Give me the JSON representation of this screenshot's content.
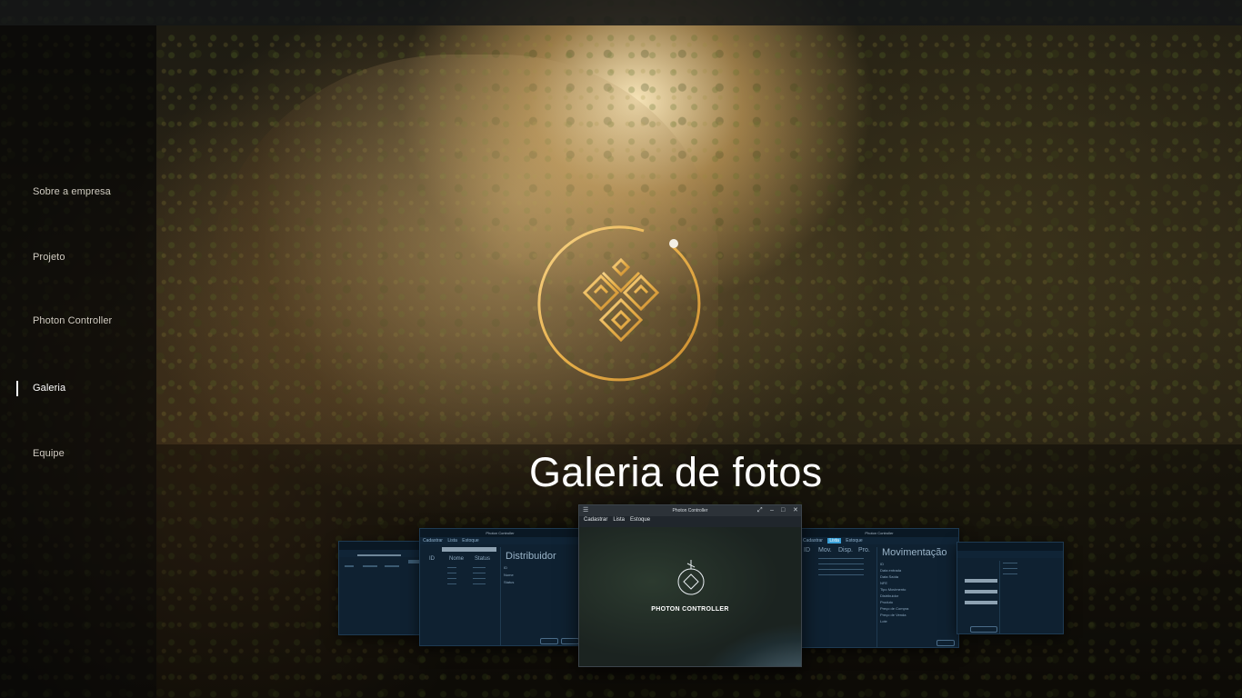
{
  "nav": {
    "items": [
      {
        "label": "Sobre a empresa",
        "active": false
      },
      {
        "label": "Projeto",
        "active": false
      },
      {
        "label": "Photon Controller",
        "active": false
      },
      {
        "label": "Galeria",
        "active": true
      },
      {
        "label": "Equipe",
        "active": false
      }
    ]
  },
  "gallery": {
    "title": "Galeria de fotos"
  },
  "screens": {
    "main": {
      "window_title": "Photon Controller",
      "menu": [
        "Cadastrar",
        "Lista",
        "Estoque"
      ],
      "brand": "PHOTON CONTROLLER"
    },
    "distribuidor": {
      "window_title": "Photon Controller",
      "menu": [
        "Cadastrar",
        "Lista",
        "Estoque"
      ],
      "heading": "Distribuidor",
      "columns": [
        "ID",
        "Nome",
        "Status"
      ],
      "fields": [
        "ID",
        "Nome",
        "Status"
      ]
    },
    "movimentacao": {
      "window_title": "Photon Controller",
      "menu": [
        "Cadastrar",
        "Lista",
        "Estoque"
      ],
      "heading": "Movimentação",
      "columns": [
        "ID",
        "Mov.",
        "Disp.",
        "Pro."
      ],
      "fields": [
        "ID",
        "Data entrada",
        "Data Saída",
        "NFE",
        "Tipo Movimento",
        "Distribuidor",
        "Produto",
        "Preço de Compra",
        "Preço de Venda",
        "Lote"
      ]
    }
  },
  "colors": {
    "accent_gold": "#e8b04a",
    "sidebar_bg": "#060605",
    "card_bg": "#0f2131"
  }
}
